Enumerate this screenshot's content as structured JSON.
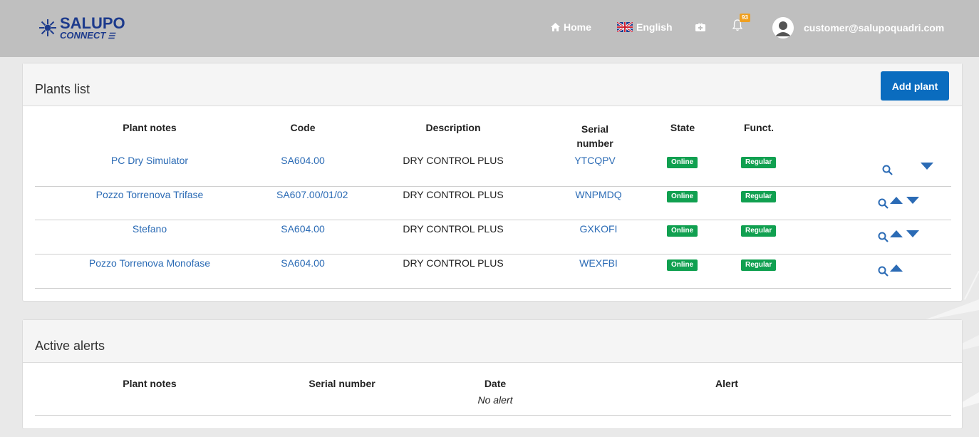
{
  "nav": {
    "brand_line1": "SALUPO",
    "brand_line2": "CONNECT",
    "home_label": "Home",
    "language_label": "English",
    "notifications_count": "93",
    "user_email": "customer@salupoquadri.com"
  },
  "plants": {
    "title": "Plants list",
    "add_button": "Add plant",
    "headers": {
      "notes": "Plant notes",
      "code": "Code",
      "description": "Description",
      "serial": "Serial number",
      "state": "State",
      "funct": "Funct."
    },
    "rows": [
      {
        "notes": "PC Dry Simulator",
        "code": "SA604.00",
        "description": "DRY CONTROL PLUS",
        "serial": "YTCQPV",
        "state": "Online",
        "funct": "Regular"
      },
      {
        "notes": "Pozzo Torrenova Trifase",
        "code": "SA607.00/01/02",
        "description": "DRY CONTROL PLUS",
        "serial": "WNPMDQ",
        "state": "Online",
        "funct": "Regular"
      },
      {
        "notes": "Stefano",
        "code": "SA604.00",
        "description": "DRY CONTROL PLUS",
        "serial": "GXKOFI",
        "state": "Online",
        "funct": "Regular"
      },
      {
        "notes": "Pozzo Torrenova Monofase",
        "code": "SA604.00",
        "description": "DRY CONTROL PLUS",
        "serial": "WEXFBI",
        "state": "Online",
        "funct": "Regular"
      }
    ]
  },
  "alerts": {
    "title": "Active alerts",
    "headers": {
      "notes": "Plant notes",
      "serial": "Serial number",
      "date": "Date",
      "alert": "Alert"
    },
    "empty_text": "No alert"
  },
  "colors": {
    "accent": "#0a6cbf",
    "link": "#2b6bb5",
    "status_green": "#10a050",
    "navbar": "#bfbfbf",
    "brand": "#1c3a8c"
  }
}
